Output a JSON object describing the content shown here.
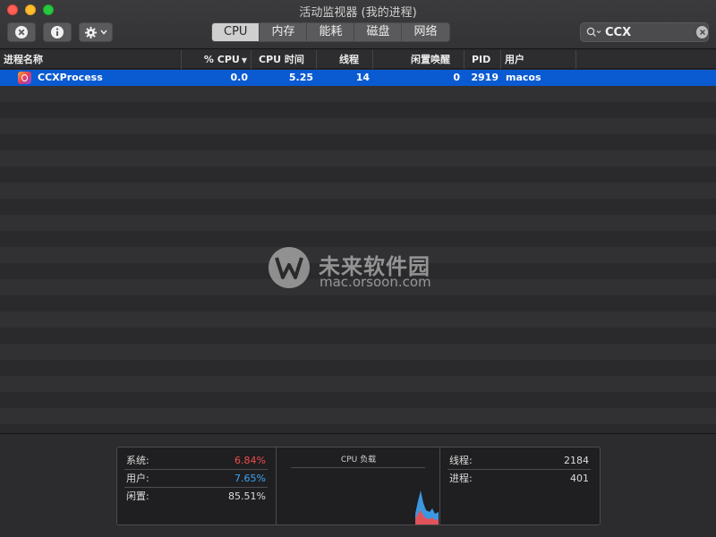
{
  "window": {
    "title": "活动监视器 (我的进程)"
  },
  "toolbar": {
    "tabs": [
      {
        "label": "CPU",
        "active": true
      },
      {
        "label": "内存",
        "active": false
      },
      {
        "label": "能耗",
        "active": false
      },
      {
        "label": "磁盘",
        "active": false
      },
      {
        "label": "网络",
        "active": false
      }
    ],
    "search": {
      "value": "CCX",
      "placeholder": ""
    }
  },
  "table": {
    "columns": {
      "name": "进程名称",
      "cpu_pct": "% CPU",
      "cpu_time": "CPU 时间",
      "threads": "线程",
      "idle_wakeups": "闲置唤醒",
      "pid": "PID",
      "user": "用户"
    },
    "rows": [
      {
        "name": "CCXProcess",
        "cpu_pct": "0.0",
        "cpu_time": "5.25",
        "threads": "14",
        "idle_wakeups": "0",
        "pid": "2919",
        "user": "macos",
        "selected": true
      }
    ]
  },
  "watermark": {
    "text": "未来软件园",
    "sub": "mac.orsoon.com"
  },
  "stats": {
    "system_label": "系统:",
    "system_value": "6.84%",
    "user_label": "用户:",
    "user_value": "7.65%",
    "idle_label": "闲置:",
    "idle_value": "85.51%",
    "cpu_load_title": "CPU 负载",
    "threads_label": "线程:",
    "threads_value": "2184",
    "processes_label": "进程:",
    "processes_value": "401"
  },
  "colors": {
    "system": "#f24b4b",
    "user": "#3fa5f5",
    "selection": "#0a5bd1"
  }
}
